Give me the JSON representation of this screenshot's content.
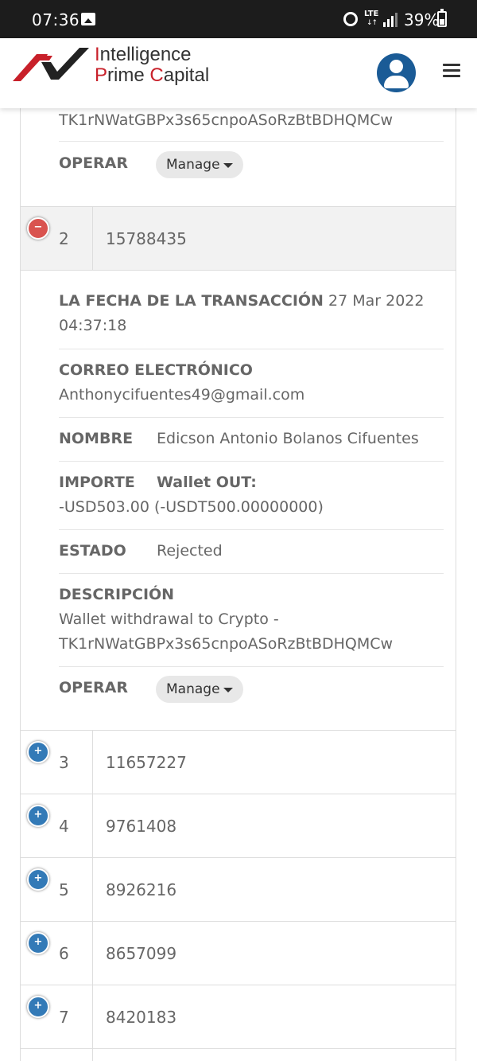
{
  "status_bar": {
    "time": "07:36",
    "network": "LTE",
    "battery": "39%"
  },
  "header": {
    "logo_line1": "Intelligence",
    "logo_line2": "Prime Capital",
    "brand_color": "#c8202a",
    "avatar_color": "#1a5b96"
  },
  "top_partial": {
    "description_tail": "TK1rNWatGBPx3s65cnpoASoRzBtBDHQMCw",
    "operate_label": "OPERAR",
    "manage_label": "Manage"
  },
  "expanded_row": {
    "index": "2",
    "id": "15788435",
    "date_label": "LA FECHA DE LA TRANSACCIÓN",
    "date_value_1": "27 Mar 2022",
    "date_value_2": "04:37:18",
    "email_label": "CORREO ELECTRÓNICO",
    "email_value": "Anthonycifuentes49@gmail.com",
    "name_label": "NOMBRE",
    "name_value": "Edicson Antonio Bolanos Cifuentes",
    "amount_label": "IMPORTE",
    "amount_wallet": "Wallet OUT:",
    "amount_value": "-USD503.00 (-USDT500.00000000)",
    "status_label": "ESTADO",
    "status_value": "Rejected",
    "description_label": "DESCRIPCIÓN",
    "description_line1": "Wallet withdrawal to Crypto -",
    "description_line2": "TK1rNWatGBPx3s65cnpoASoRzBtBDHQMCw",
    "operate_label": "OPERAR",
    "manage_label": "Manage"
  },
  "rows": [
    {
      "index": "3",
      "id": "11657227"
    },
    {
      "index": "4",
      "id": "9761408"
    },
    {
      "index": "5",
      "id": "8926216"
    },
    {
      "index": "6",
      "id": "8657099"
    },
    {
      "index": "7",
      "id": "8420183"
    }
  ],
  "icons": {
    "expand": "plus-circle-icon",
    "collapse": "minus-circle-icon"
  }
}
